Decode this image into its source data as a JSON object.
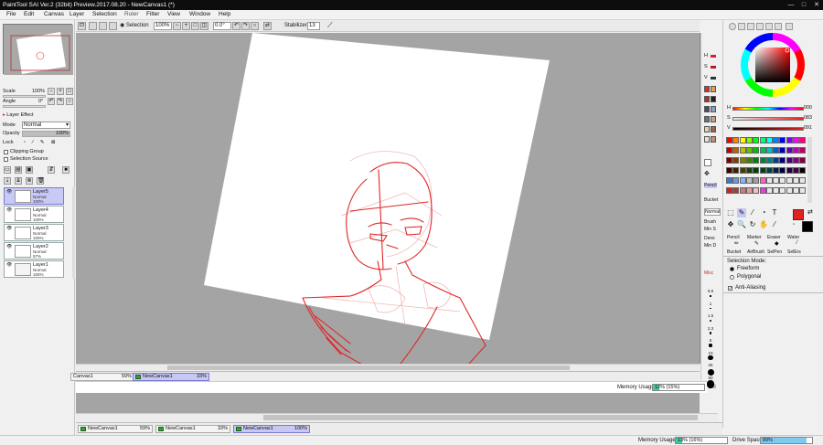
{
  "window": {
    "title": "PaintTool SAI Ver.2 (32bit) Preview.2017.08.20 - NewCanvas1 (*)",
    "minimize": "—",
    "maximize": "□",
    "close": "✕"
  },
  "menu": [
    "File",
    "Edit",
    "Canvas",
    "Layer",
    "Selection",
    "Filter",
    "View",
    "Window",
    "Help"
  ],
  "menu_ruler": "Ruler",
  "navigator": {
    "scale_label": "Scale",
    "scale_value": "100%",
    "angle_label": "Angle",
    "angle_value": "0°"
  },
  "layer_panel": {
    "effect_label": "Layer Effect",
    "mode_label": "Mode",
    "mode_value": "Normal",
    "opacity_label": "Opacity",
    "opacity_value": "100%",
    "lock_label": "Lock",
    "clipping_label": "Clipping Group",
    "selection_source_label": "Selection Source",
    "layers": [
      {
        "name": "Layer5",
        "mode": "Normal",
        "opacity": "100%",
        "selected": true
      },
      {
        "name": "Layer4",
        "mode": "Normal",
        "opacity": "100%",
        "selected": false
      },
      {
        "name": "Layer3",
        "mode": "Normal",
        "opacity": "100%",
        "selected": false
      },
      {
        "name": "Layer2",
        "mode": "Normal",
        "opacity": "57%",
        "selected": false
      },
      {
        "name": "Layer1",
        "mode": "Normal",
        "opacity": "100%",
        "selected": false
      }
    ]
  },
  "toolbar": {
    "selection_label": "Selection",
    "zoom_value": "100%",
    "angle_value": "0.0°",
    "stabilizer_label": "Stabilizer",
    "stabilizer_value": "13"
  },
  "inner_tabs": [
    {
      "name": "Canvas1",
      "pct": "59%"
    },
    {
      "name": "NewCanvas1",
      "pct": "33%"
    }
  ],
  "inner_memory": {
    "label": "Memory Usage",
    "value": "12% (15%)",
    "percent": 12,
    "truncated": "Dri"
  },
  "outer_tabs": [
    {
      "name": "NewCanvas1",
      "pct": "59%"
    },
    {
      "name": "NewCanvas1",
      "pct": "33%"
    },
    {
      "name": "NewCanvas1",
      "pct": "100%"
    }
  ],
  "status": {
    "memory_label": "Memory Usage",
    "memory_value": "13% (16%)",
    "memory_percent": 13,
    "drive_label": "Drive Space",
    "drive_value": "89%",
    "drive_percent": 89
  },
  "color_panel": {
    "h_label": "H",
    "h_value": "000",
    "s_label": "S",
    "s_value": "083",
    "v_label": "V",
    "v_value": "091",
    "main_color": "#e41f1f",
    "palette": [
      "#ff0000",
      "#ff8000",
      "#ffff00",
      "#80ff00",
      "#00ff00",
      "#00ff80",
      "#00ffff",
      "#0080ff",
      "#0000ff",
      "#8000ff",
      "#ff00ff",
      "#ff0080",
      "#c00000",
      "#c06000",
      "#c0c000",
      "#60c000",
      "#00c000",
      "#00c060",
      "#00c0c0",
      "#0060c0",
      "#0000c0",
      "#6000c0",
      "#c000c0",
      "#c00060",
      "#800000",
      "#804000",
      "#808000",
      "#408000",
      "#008000",
      "#008040",
      "#008080",
      "#004080",
      "#000080",
      "#400080",
      "#800080",
      "#800040",
      "#400000",
      "#402000",
      "#404000",
      "#204000",
      "#004000",
      "#004020",
      "#004040",
      "#002040",
      "#000040",
      "#200040",
      "#400040",
      "#000000",
      "#3a78d0",
      "#6a9ad8",
      "#80b8ff",
      "#c0c0c0",
      "#a0a0a0",
      "#ff60c0",
      "#e8e8e8",
      "#e8e8e8",
      "#e8e8e8",
      "#e8e8e8",
      "#e8e8e8",
      "#e8e8e8",
      "#d02020",
      "#a04040",
      "#c08080",
      "#e0a0a0",
      "#f0c0c0",
      "#e040e0",
      "#e8e8e8",
      "#e8e8e8",
      "#e8e8e8",
      "#e8e8e8",
      "#e8e8e8",
      "#e8e8e8"
    ]
  },
  "tools": {
    "row1": [
      "Pencil",
      "Marker",
      "Eraser",
      "Water"
    ],
    "row2": [
      "Bucket",
      "AirBrush",
      "SelPen",
      "SelErs"
    ],
    "selection_mode_label": "Selection Mode:",
    "freeform_label": "Freeform",
    "polygonal_label": "Polygonal",
    "anti_aliasing_label": "Anti-Aliasing"
  },
  "brush_strip": {
    "labels": [
      "Pencil",
      "Bucket",
      "Normal",
      "Brush",
      "Min S",
      "Dens",
      "Min D",
      "Misc"
    ],
    "sizes": [
      "0.6",
      "1",
      "1.5",
      "2.3",
      "5",
      "10",
      "25",
      "60"
    ]
  },
  "swatch_strip": {
    "hsv": [
      "H",
      "S",
      "V"
    ],
    "colors": [
      "#cc3030",
      "#e0a050",
      "#b0302a",
      "#202020",
      "#4a4a60",
      "#88a0b8",
      "#6a7080",
      "#c8a080",
      "#e0d0b0",
      "#a06050",
      "#e8e0d8",
      "#c09070"
    ]
  }
}
